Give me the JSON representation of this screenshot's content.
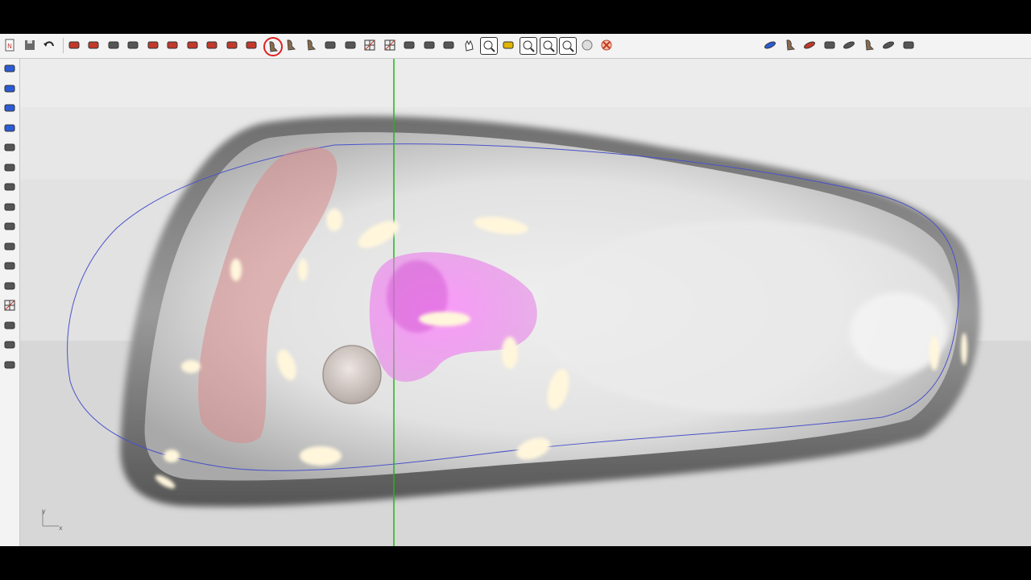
{
  "app": {
    "title": ""
  },
  "toolbar": {
    "groups": [
      {
        "name": "file",
        "icons": [
          "new-document-icon",
          "save-icon",
          "undo-icon"
        ]
      },
      {
        "name": "insole-tools",
        "icons": [
          "red-shape-tool-icon",
          "red-block-tool-icon",
          "pillar-tool-icon",
          "panel-tool-icon",
          "pad-tool-icon-1",
          "pad-tool-icon-2",
          "pad-tool-icon-3",
          "pad-tool-icon-4",
          "blob-tool-icon",
          "loop-tool-icon",
          "foot-select-icon",
          "foot-pair-icon",
          "boot-icon",
          "wedge-tool-icon",
          "bar-tool-icon",
          "grid-off-icon",
          "grid-icon",
          "measure-icon",
          "cursor-arrow-icon",
          "move-icon",
          "pan-hand-icon",
          "zoom-icon",
          "pencil-tool-icon",
          "zoom-window-icon",
          "zoom-extents-icon",
          "zoom-selected-icon",
          "sphere-icon",
          "delete-icon"
        ]
      },
      {
        "name": "right-tools",
        "icons": [
          "insole-blue-icon",
          "shoe-gray-icon",
          "insole-red-icon",
          "height-adjust-icon",
          "flat-insole-icon",
          "foot-outline-icon",
          "pair-insole-icon",
          "layers-icon"
        ]
      }
    ]
  },
  "sidebar": {
    "icons": [
      "view-top-icon",
      "view-side-icon",
      "view-heel-icon",
      "view-angle-icon",
      "edit-curve-icon",
      "color-block-icon",
      "prism-icon",
      "slope-icon",
      "arc-icon",
      "pin-icon",
      "dimension-icon",
      "cross-section-icon",
      "grid-points-icon",
      "settings-wheel-icon",
      "wave-icon",
      "folder-icon"
    ]
  },
  "viewport": {
    "axis": {
      "x_label": "x",
      "y_label": "y"
    },
    "colors": {
      "background": "#e2e2e2",
      "insole_surface": "#c9c9c9",
      "outline_curve": "#4a52c9",
      "guide_line": "#1fb51f",
      "heel_pad": "#d98a8a",
      "forefoot_pad": "#e060e0",
      "marker_sphere": "#b8a8a0"
    }
  }
}
